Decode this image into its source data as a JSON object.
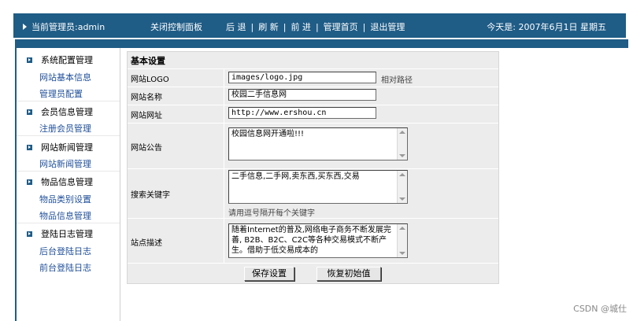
{
  "topbar": {
    "admin_label": "当前管理员:admin",
    "close_panel": "关闭控制面板",
    "nav": [
      "后 退",
      "刷 新",
      "前 进",
      "管理首页",
      "退出管理"
    ],
    "date": "今天是: 2007年6月1日 星期五"
  },
  "sidebar": {
    "sections": [
      {
        "title": "系统配置管理",
        "items": [
          "网站基本信息",
          "管理员配置"
        ]
      },
      {
        "title": "会员信息管理",
        "items": [
          "注册会员管理"
        ]
      },
      {
        "title": "网站新闻管理",
        "items": [
          "网站新闻管理"
        ]
      },
      {
        "title": "物品信息管理",
        "items": [
          "物品类别设置",
          "物品信息管理"
        ]
      },
      {
        "title": "登陆日志管理",
        "items": [
          "后台登陆日志",
          "前台登陆日志"
        ]
      }
    ]
  },
  "form": {
    "heading": "基本设置",
    "logo_label": "网站LOGO",
    "logo_value": "images/logo.jpg",
    "logo_hint": "相对路径",
    "name_label": "网站名称",
    "name_value": "校园二手信息网",
    "url_label": "网站网址",
    "url_value": "http://www.ershou.cn",
    "notice_label": "网站公告",
    "notice_value": "校园信息网开通啦!!!",
    "keywords_label": "搜索关键字",
    "keywords_value": "二手信息,二手网,卖东西,买东西,交易",
    "keywords_hint": "请用逗号隔开每个关键字",
    "desc_label": "站点描述",
    "desc_value": "随着Internet的普及,网络电子商务不断发展完善, B2B、B2C、C2C等各种交易模式不断产生。借助于低交易成本的",
    "save_button": "保存设置",
    "reset_button": "恢复初始值"
  },
  "watermark": "CSDN @城仕"
}
